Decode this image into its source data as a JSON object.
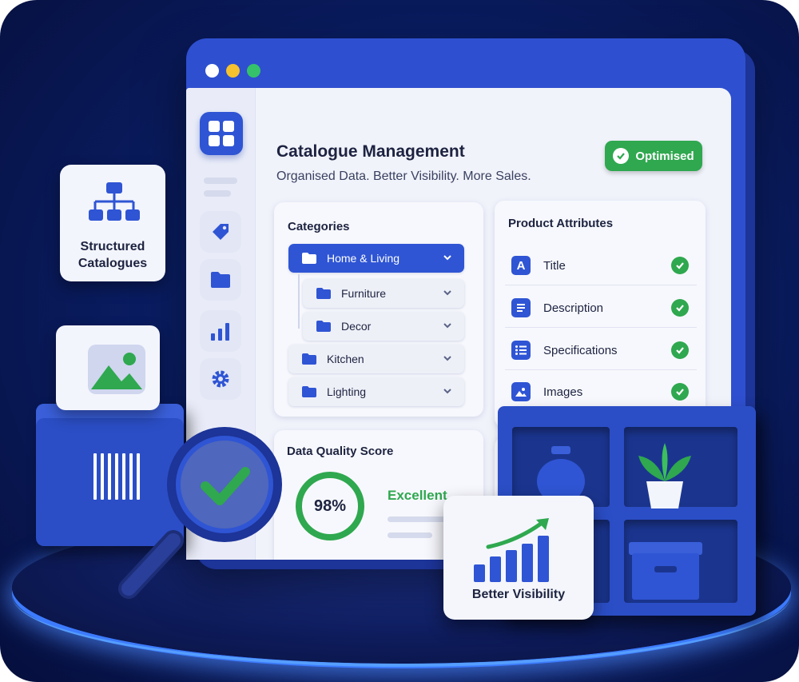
{
  "header": {
    "title": "Catalogue Management",
    "subtitle": "Organised Data. Better Visibility. More Sales.",
    "badge": "Optimised"
  },
  "sidebar": {
    "items": [
      {
        "icon": "tag-icon"
      },
      {
        "icon": "folder-icon"
      },
      {
        "icon": "bar-chart-icon"
      },
      {
        "icon": "gear-icon"
      }
    ]
  },
  "categories": {
    "title": "Categories",
    "items": [
      {
        "label": "Home & Living",
        "active": true
      },
      {
        "label": "Furniture",
        "sub": true
      },
      {
        "label": "Decor",
        "sub": true
      },
      {
        "label": "Kitchen"
      },
      {
        "label": "Lighting"
      }
    ]
  },
  "attributes": {
    "title": "Product Attributes",
    "items": [
      {
        "label": "Title",
        "icon": "letter-a-icon"
      },
      {
        "label": "Description",
        "icon": "document-icon"
      },
      {
        "label": "Specifications",
        "icon": "list-icon"
      },
      {
        "label": "Images",
        "icon": "image-icon"
      }
    ]
  },
  "quality": {
    "title": "Data Quality Score",
    "score": "98%",
    "rating": "Excellent"
  },
  "floating": {
    "structured": [
      "Structured",
      "Catalogues"
    ],
    "visibility": "Better Visibility"
  },
  "colors": {
    "brand_blue": "#2f55d4",
    "success_green": "#2fa84f",
    "background_navy": "#0a1d63"
  }
}
